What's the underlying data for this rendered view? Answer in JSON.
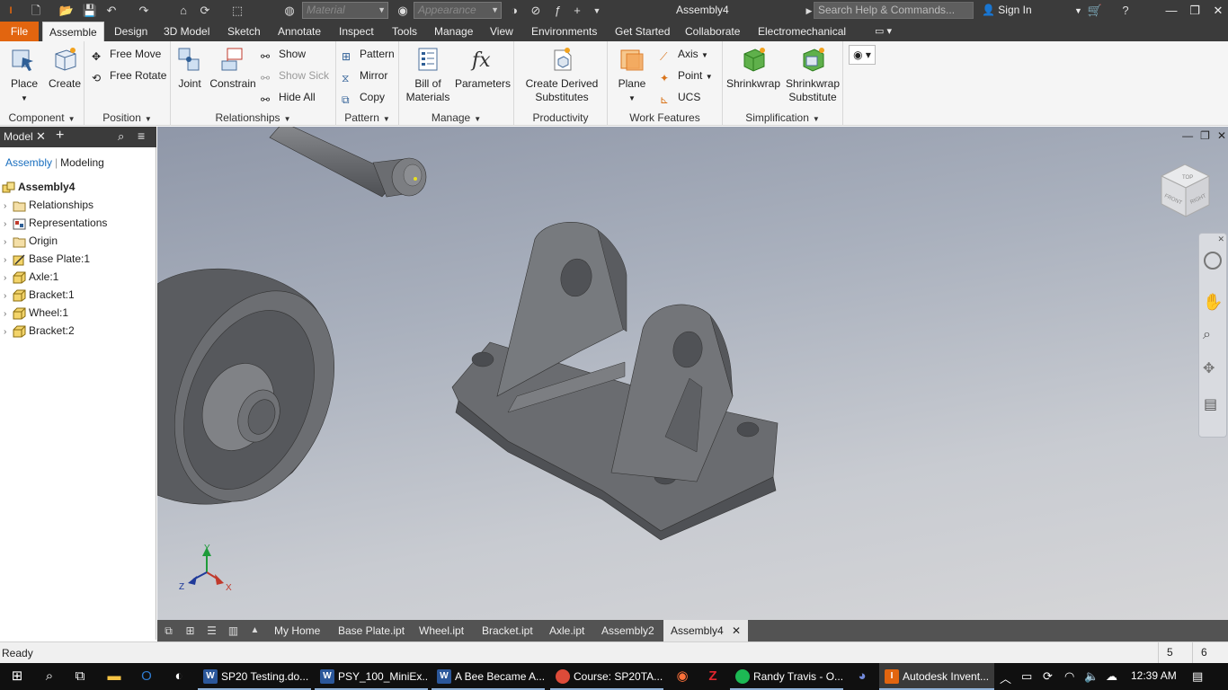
{
  "titlebar": {
    "material_placeholder": "Material",
    "appearance_placeholder": "Appearance",
    "title": "Assembly4",
    "search_placeholder": "Search Help & Commands...",
    "sign_in": "Sign In"
  },
  "tabs": [
    "File",
    "Assemble",
    "Design",
    "3D Model",
    "Sketch",
    "Annotate",
    "Inspect",
    "Tools",
    "Manage",
    "View",
    "Environments",
    "Get Started",
    "Collaborate",
    "Electromechanical"
  ],
  "active_tab": "Assemble",
  "ribbon": {
    "component": {
      "label": "Component",
      "place": "Place",
      "create": "Create"
    },
    "position": {
      "label": "Position",
      "free_move": "Free Move",
      "free_rotate": "Free Rotate"
    },
    "relationships": {
      "label": "Relationships",
      "joint": "Joint",
      "constrain": "Constrain",
      "show": "Show",
      "show_sick": "Show Sick",
      "hide_all": "Hide All"
    },
    "pattern": {
      "label": "Pattern",
      "pattern": "Pattern",
      "mirror": "Mirror",
      "copy": "Copy"
    },
    "manage": {
      "label": "Manage",
      "bom_line1": "Bill of",
      "bom_line2": "Materials",
      "parameters": "Parameters"
    },
    "productivity": {
      "label": "Productivity",
      "cds_line1": "Create Derived",
      "cds_line2": "Substitutes"
    },
    "work_features": {
      "label": "Work Features",
      "plane": "Plane",
      "axis": "Axis",
      "point": "Point",
      "ucs": "UCS"
    },
    "simplification": {
      "label": "Simplification",
      "shrinkwrap": "Shrinkwrap",
      "sws_line1": "Shrinkwrap",
      "sws_line2": "Substitute"
    }
  },
  "browser": {
    "title": "Model",
    "tab_assembly": "Assembly",
    "tab_modeling": "Modeling",
    "root": "Assembly4",
    "items": [
      {
        "label": "Relationships",
        "icon": "folder-icon"
      },
      {
        "label": "Representations",
        "icon": "representations-icon"
      },
      {
        "label": "Origin",
        "icon": "folder-icon"
      },
      {
        "label": "Base Plate:1",
        "icon": "grounded-part-icon"
      },
      {
        "label": "Axle:1",
        "icon": "part-icon"
      },
      {
        "label": "Bracket:1",
        "icon": "part-icon"
      },
      {
        "label": "Wheel:1",
        "icon": "part-icon"
      },
      {
        "label": "Bracket:2",
        "icon": "part-icon"
      }
    ]
  },
  "viewcube": {
    "top": "TOP",
    "front": "FRONT",
    "right": "RIGHT"
  },
  "triad": {
    "x": "X",
    "y": "Y",
    "z": "Z"
  },
  "doc_tabs": [
    "My Home",
    "Base Plate.ipt",
    "Wheel.ipt",
    "Bracket.ipt",
    "Axle.ipt",
    "Assembly2",
    "Assembly4"
  ],
  "active_doc": "Assembly4",
  "status": {
    "text": "Ready",
    "count1": "5",
    "count2": "6"
  },
  "taskbar": {
    "apps": [
      {
        "label": "SP20 Testing.do...",
        "icon": "W",
        "color": "#2b579a"
      },
      {
        "label": "PSY_100_MiniEx...",
        "icon": "W",
        "color": "#2b579a"
      },
      {
        "label": "A Bee Became A...",
        "icon": "W",
        "color": "#2b579a"
      },
      {
        "label": "Course: SP20TA...",
        "icon": "chrome-icon",
        "color": "#dd4b39"
      },
      {
        "label": "Randy Travis - O...",
        "icon": "spotify-icon",
        "color": "#1db954"
      },
      {
        "label": "Autodesk Invent...",
        "icon": "I",
        "color": "#e2650f"
      }
    ],
    "time": "12:39 AM"
  },
  "colors": {
    "file_tab": "#e2650f",
    "accent_blue": "#1a6fbf",
    "dark_chrome": "#3b3b3b"
  }
}
